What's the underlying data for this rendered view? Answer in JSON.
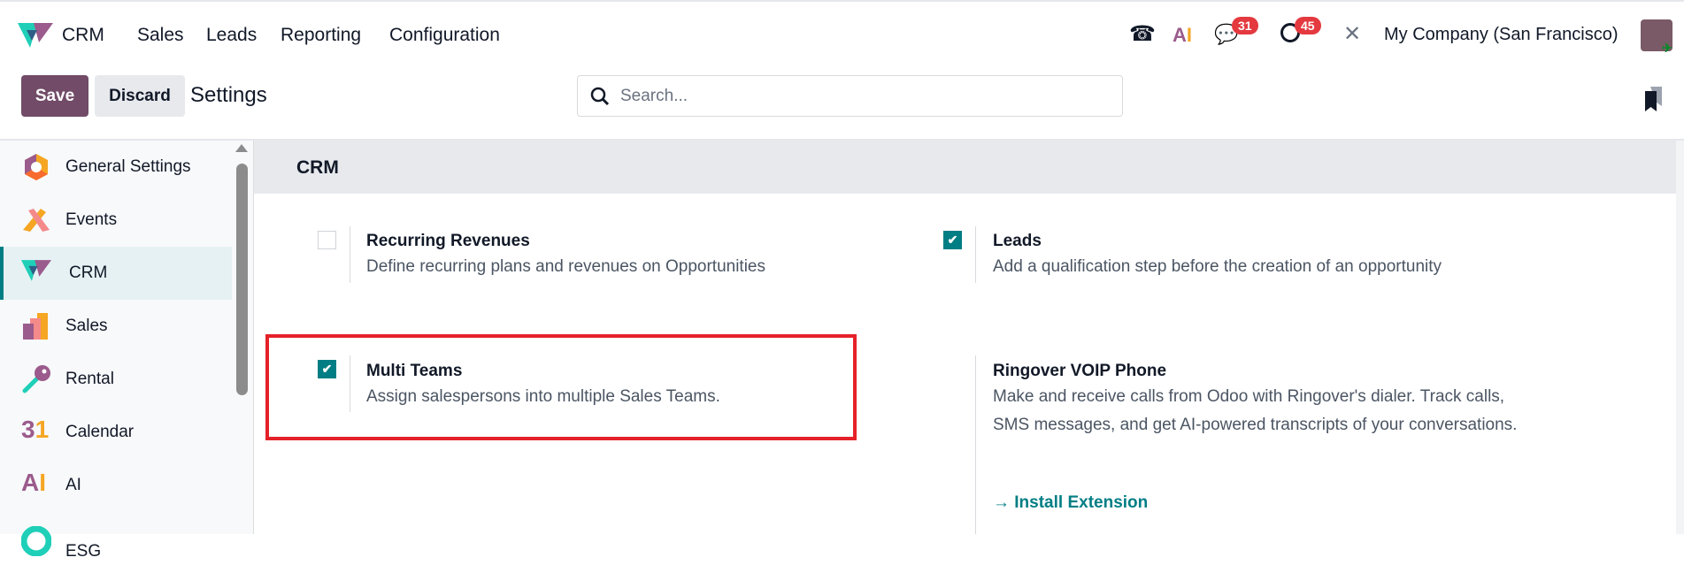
{
  "topbar": {
    "app": "CRM",
    "menu": [
      "Sales",
      "Leads",
      "Reporting",
      "Configuration"
    ],
    "messages_count": "31",
    "activities_count": "45",
    "company": "My Company (San Francisco)"
  },
  "controls": {
    "save": "Save",
    "discard": "Discard",
    "title": "Settings",
    "search_placeholder": "Search..."
  },
  "sidebar": {
    "items": [
      {
        "label": "General Settings"
      },
      {
        "label": "Events"
      },
      {
        "label": "CRM"
      },
      {
        "label": "Sales"
      },
      {
        "label": "Rental"
      },
      {
        "label": "Calendar"
      },
      {
        "label": "AI"
      },
      {
        "label": "ESG"
      }
    ]
  },
  "section": {
    "title": "CRM",
    "settings": [
      {
        "title": "Recurring Revenues",
        "desc": "Define recurring plans and revenues on Opportunities",
        "checked": false
      },
      {
        "title": "Leads",
        "desc": "Add a qualification step before the creation of an opportunity",
        "checked": true
      },
      {
        "title": "Multi Teams",
        "desc": "Assign salespersons into multiple Sales Teams.",
        "checked": true
      },
      {
        "title": "Ringover VOIP Phone",
        "desc": "Make and receive calls from Odoo with Ringover's dialer. Track calls, SMS messages, and get AI-powered transcripts of your conversations.",
        "link": "Install Extension"
      }
    ]
  },
  "colors": {
    "primary": "#714b67",
    "accent": "#017e84",
    "highlight": "#e52129",
    "badge": "#e4393f"
  }
}
